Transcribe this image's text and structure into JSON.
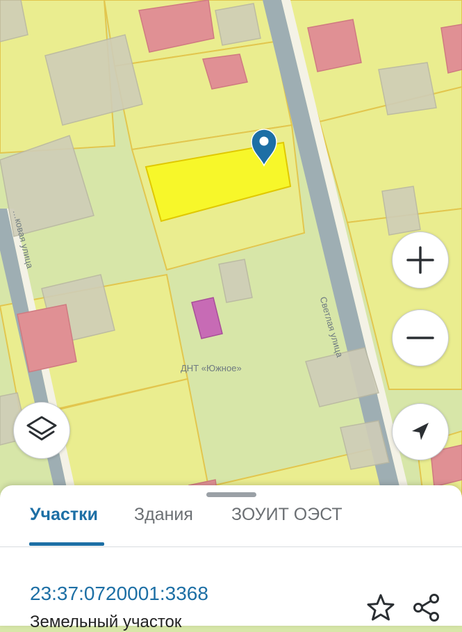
{
  "map": {
    "labels": {
      "dnt": "ДНТ «Южное»",
      "street_right": "Светлая улица",
      "street_left": "…ковая улица"
    },
    "colors": {
      "base": "#d7e6a8",
      "parcel": "#ecee8e",
      "parcel_border": "#e3c54a",
      "selected_parcel": "#f7f72a",
      "road": "#9eaeb3",
      "road_edge": "#f4f2e6",
      "building_red": "#e09094",
      "building_magenta": "#c76bb5",
      "building_gray": "#cfcdb8",
      "pin": "#1d6fa5"
    },
    "marker_icon": "map-pin-icon"
  },
  "controls": {
    "zoom_in_icon": "plus-icon",
    "zoom_out_icon": "minus-icon",
    "locate_icon": "navigation-arrow-icon",
    "layers_icon": "layers-icon"
  },
  "sheet": {
    "tabs": [
      {
        "label": "Участки",
        "active": true
      },
      {
        "label": "Здания",
        "active": false
      },
      {
        "label": "ЗОУИТ ОЭСТ",
        "active": false
      }
    ],
    "object": {
      "cadastral_number": "23:37:0720001:3368",
      "type": "Земельный участок"
    },
    "actions": {
      "favorite_icon": "star-icon",
      "share_icon": "share-icon"
    }
  }
}
